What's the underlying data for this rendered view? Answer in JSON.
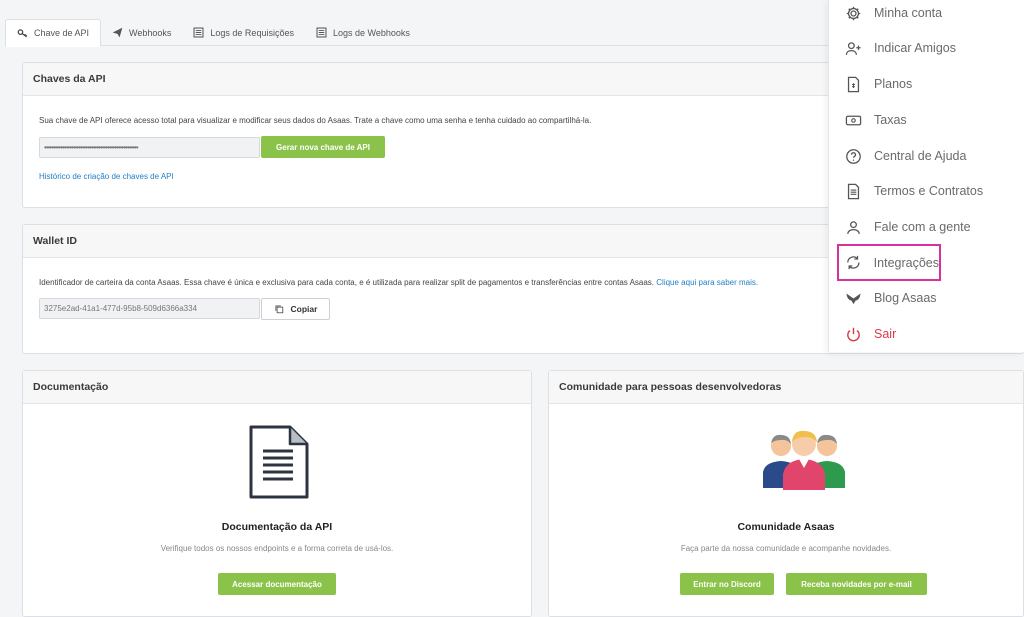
{
  "tabs": [
    {
      "label": "Chave de API",
      "icon": "key-icon"
    },
    {
      "label": "Webhooks",
      "icon": "paper-plane-icon"
    },
    {
      "label": "Logs de Requisições",
      "icon": "list-icon"
    },
    {
      "label": "Logs de Webhooks",
      "icon": "list-icon"
    }
  ],
  "api_keys": {
    "title": "Chaves da API",
    "description": "Sua chave de API oferece acesso total para visualizar e modificar seus dados do Asaas. Trate a chave como uma senha e tenha cuidado ao compartilhá-la.",
    "masked_key": "••••••••••••••••••••••••••••••••••••••••••••••••••••",
    "generate_button": "Gerar nova chave de API",
    "history_link": "Histórico de criação de chaves de API"
  },
  "wallet": {
    "title": "Wallet ID",
    "description": "Identificador de carteira da conta Asaas. Essa chave é única e exclusiva para cada conta, e é utilizada para realizar split de pagamentos e transferências entre contas Asaas.",
    "learn_more": "Clique aqui para saber mais.",
    "wallet_id": "3275e2ad-41a1-477d-95b8-509d6366a334",
    "copy_button": "Copiar"
  },
  "docs": {
    "title": "Documentação",
    "card_title": "Documentação da API",
    "card_sub": "Verifique todos os nossos endpoints e a forma correta de usá-los.",
    "button": "Acessar documentação"
  },
  "community": {
    "title": "Comunidade para pessoas desenvolvedoras",
    "card_title": "Comunidade Asaas",
    "card_sub": "Faça parte da nossa comunidade e acompanhe novidades.",
    "discord_button": "Entrar no Discord",
    "email_button": "Receba novidades por e-mail"
  },
  "menu": [
    {
      "label": "Minha conta",
      "icon": "gear-icon"
    },
    {
      "label": "Indicar Amigos",
      "icon": "add-user-icon"
    },
    {
      "label": "Planos",
      "icon": "document-dollar-icon"
    },
    {
      "label": "Taxas",
      "icon": "banknote-icon"
    },
    {
      "label": "Central de Ajuda",
      "icon": "help-circle-icon"
    },
    {
      "label": "Termos e Contratos",
      "icon": "document-icon"
    },
    {
      "label": "Fale com a gente",
      "icon": "user-icon"
    },
    {
      "label": "Integrações",
      "icon": "refresh-icon"
    },
    {
      "label": "Blog Asaas",
      "icon": "butterfly-icon"
    },
    {
      "label": "Sair",
      "icon": "power-icon"
    }
  ],
  "colors": {
    "accent_green": "#8bc34a",
    "link_blue": "#1f7fc4",
    "highlight_pink": "#d6319e",
    "danger_red": "#d7394a"
  }
}
